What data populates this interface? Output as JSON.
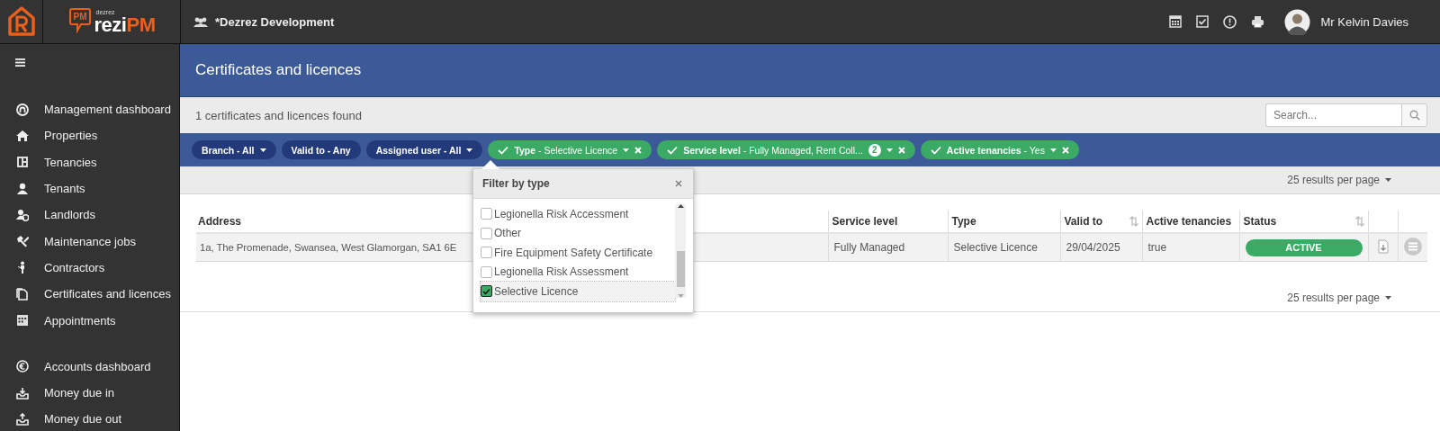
{
  "brand": {
    "badge": "PM",
    "small": "dezrez",
    "name": "rezi",
    "accent": "PM"
  },
  "topbar": {
    "workspace": "*Dezrez Development",
    "user": "Mr Kelvin Davies"
  },
  "sidebar": {
    "groups": [
      {
        "items": [
          {
            "label": "Management dashboard"
          },
          {
            "label": "Properties"
          },
          {
            "label": "Tenancies"
          },
          {
            "label": "Tenants"
          },
          {
            "label": "Landlords"
          },
          {
            "label": "Maintenance jobs"
          },
          {
            "label": "Contractors"
          },
          {
            "label": "Certificates and licences"
          },
          {
            "label": "Appointments"
          }
        ]
      },
      {
        "items": [
          {
            "label": "Accounts dashboard"
          },
          {
            "label": "Money due in"
          },
          {
            "label": "Money due out"
          }
        ]
      }
    ]
  },
  "page": {
    "title": "Certificates and licences",
    "count_text": "1 certificates and licences found",
    "search": {
      "placeholder": "Search..."
    }
  },
  "filters": [
    {
      "label": "Branch - All",
      "active": false,
      "dropdown": true,
      "removable": false
    },
    {
      "label": "Valid to - Any",
      "active": false,
      "dropdown": false,
      "removable": false
    },
    {
      "label": "Assigned user - All",
      "active": false,
      "dropdown": true,
      "removable": false
    },
    {
      "label": "**Type** - Selective Licence",
      "active": true,
      "dropdown": true,
      "removable": true
    },
    {
      "label": "**Service level** - Fully Managed, Rent Coll...",
      "active": true,
      "dropdown": true,
      "removable": true,
      "count": "2"
    },
    {
      "label": "**Active tenancies** - Yes",
      "active": true,
      "dropdown": true,
      "removable": true
    }
  ],
  "results_per_page": [
    "25 results per page",
    "25 results per page"
  ],
  "table": {
    "columns": [
      {
        "label": "Address",
        "sortable": false
      },
      {
        "label": "Service level",
        "sortable": false
      },
      {
        "label": "Type",
        "sortable": false
      },
      {
        "label": "Valid to",
        "sortable": true
      },
      {
        "label": "Active tenancies",
        "sortable": false
      },
      {
        "label": "Status",
        "sortable": true
      }
    ],
    "rows": [
      {
        "cells": [
          "1a, The Promenade, Swansea, West Glamorgan, SA1 6E",
          "Fully Managed",
          "Selective Licence",
          "29/04/2025",
          "true"
        ],
        "status": "ACTIVE"
      }
    ]
  },
  "dropdown": {
    "title": "Filter by type",
    "options": [
      {
        "label": "Legionella Risk Accessment",
        "checked": false,
        "selected": false
      },
      {
        "label": "Other",
        "checked": false,
        "selected": false
      },
      {
        "label": "Fire Equipment Safety Certificate",
        "checked": false,
        "selected": false
      },
      {
        "label": "Legionella Risk Assessment",
        "checked": false,
        "selected": false
      },
      {
        "label": "Selective Licence",
        "checked": true,
        "selected": true
      }
    ]
  }
}
